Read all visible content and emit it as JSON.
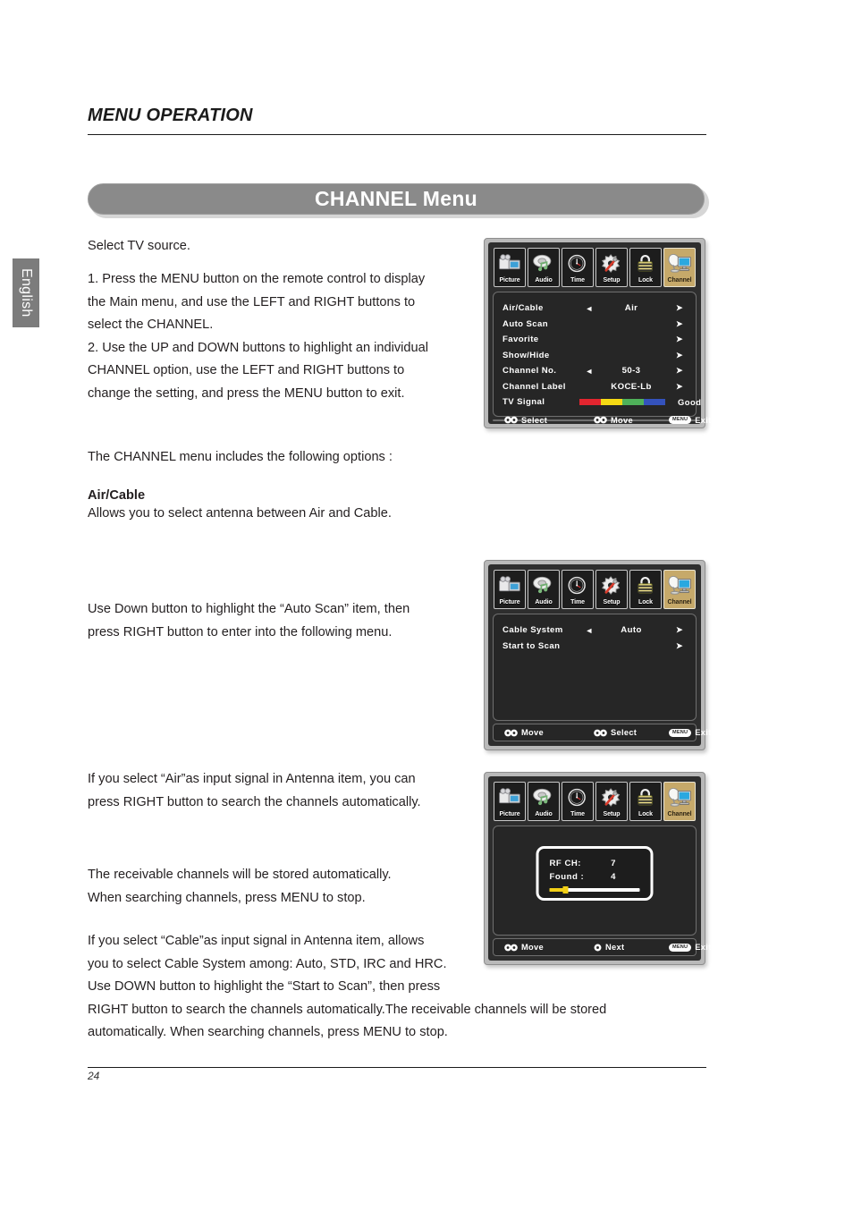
{
  "language_tab": "English",
  "header": {
    "section_title": "MENU OPERATION",
    "banner_title": "CHANNEL Menu"
  },
  "body_text": {
    "p1": "Select TV source.",
    "p2": "1. Press the MENU button on the remote control to display\nthe Main menu, and use the LEFT and RIGHT buttons to\nselect the CHANNEL.\n2. Use the UP and DOWN buttons to highlight an individual\nCHANNEL option, use the LEFT and RIGHT buttons to\nchange the setting, and press the MENU button to exit.",
    "p3": "The CHANNEL menu includes the following options :",
    "p4_heading": "Air/Cable",
    "p4": "Allows you to select antenna between Air and Cable.",
    "p5": "Use Down button to highlight the “Auto Scan” item, then\npress RIGHT button to enter into the following menu.",
    "p6": "If you select “Air”as input signal in Antenna item, you can\npress RIGHT button to search the channels automatically.",
    "p7": "The receivable channels will be stored automatically.\nWhen searching channels, press MENU to stop.",
    "p8": "If you select “Cable”as input signal in Antenna item, allows\nyou to select Cable System among: Auto, STD, IRC and HRC.\nUse DOWN button to highlight the “Start to Scan”, then press\nRIGHT button to search the channels automatically.The receivable channels will be stored\nautomatically. When searching channels, press MENU to stop."
  },
  "osd_tabs": [
    {
      "label": "Picture",
      "icon": "camera-icon",
      "active": false
    },
    {
      "label": "Audio",
      "icon": "speaker-note-icon",
      "active": false
    },
    {
      "label": "Time",
      "icon": "clock-icon",
      "active": false
    },
    {
      "label": "Setup",
      "icon": "gear-wrench-icon",
      "active": false
    },
    {
      "label": "Lock",
      "icon": "padlock-icon",
      "active": false
    },
    {
      "label": "Channel",
      "icon": "satellite-tv-icon",
      "active": true
    }
  ],
  "menu_channel": {
    "rows": [
      {
        "label": "Air/Cable",
        "left_arrow": "◄",
        "value": "Air",
        "right_arrow": "➤"
      },
      {
        "label": "Auto Scan",
        "left_arrow": "",
        "value": "",
        "right_arrow": "➤"
      },
      {
        "label": "Favorite",
        "left_arrow": "",
        "value": "",
        "right_arrow": "➤"
      },
      {
        "label": "Show/Hide",
        "left_arrow": "",
        "value": "",
        "right_arrow": "➤"
      },
      {
        "label": "Channel No.",
        "left_arrow": "◄",
        "value": "50-3",
        "right_arrow": "➤"
      },
      {
        "label": "Channel Label",
        "left_arrow": "",
        "value": "KOCE-Lb",
        "right_arrow": "➤"
      }
    ],
    "signal_row": {
      "label": "TV Signal",
      "quality": "Good",
      "segments": [
        "#e3252f",
        "#f5d914",
        "#4fb15a",
        "#3452bc"
      ]
    },
    "footer": [
      {
        "glyph": "updown-circles-icon",
        "text": "Select"
      },
      {
        "glyph": "leftright-circles-icon",
        "text": "Move"
      },
      {
        "glyph": "menu-pill",
        "pill": "MENU",
        "text": "Exit"
      }
    ]
  },
  "menu_autoscan": {
    "rows": [
      {
        "label": "Cable System",
        "left_arrow": "◄",
        "value": "Auto",
        "right_arrow": "➤"
      },
      {
        "label": "Start to Scan",
        "left_arrow": "",
        "value": "",
        "right_arrow": "➤"
      }
    ],
    "footer": [
      {
        "glyph": "updown-circles-icon",
        "text": "Move"
      },
      {
        "glyph": "leftright-circles-icon",
        "text": "Select"
      },
      {
        "glyph": "menu-pill",
        "pill": "MENU",
        "text": "Exit"
      }
    ]
  },
  "menu_scanning": {
    "dialog": {
      "rf_ch_label": "RF CH:",
      "rf_ch_value": "7",
      "found_label": "Found :",
      "found_value": "4",
      "progress_percent": 18
    },
    "footer": [
      {
        "glyph": "updown-circles-icon",
        "text": "Move"
      },
      {
        "glyph": "single-circle-icon",
        "text": "Next"
      },
      {
        "glyph": "menu-pill",
        "pill": "MENU",
        "text": "Exit"
      }
    ]
  },
  "footer": {
    "page_number": "24"
  }
}
